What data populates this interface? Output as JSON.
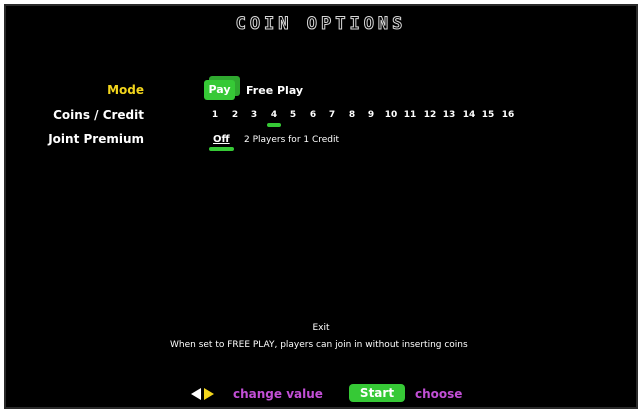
{
  "screen": {
    "title": "COIN OPTIONS"
  },
  "colors": {
    "label_active": "#f2d51c",
    "label": "#ffffff",
    "selected": "#36c936",
    "hint": "#c24fd6"
  },
  "options": [
    {
      "label": "Mode",
      "active": true,
      "values": [
        "Pay",
        "Free Play"
      ],
      "selected": "Pay"
    },
    {
      "label": "Coins / Credit",
      "active": false,
      "values": [
        "1",
        "2",
        "3",
        "4",
        "5",
        "6",
        "7",
        "8",
        "9",
        "10",
        "11",
        "12",
        "13",
        "14",
        "15",
        "16"
      ],
      "selected": "4"
    },
    {
      "label": "Joint Premium",
      "active": false,
      "values": [
        "Off",
        "2 Players for 1 Credit"
      ],
      "selected": "Off"
    }
  ],
  "exit_label": "Exit",
  "description": "When set to FREE PLAY, players can join in without inserting coins",
  "footer": {
    "change_value": "change value",
    "start": "Start",
    "choose": "choose"
  }
}
